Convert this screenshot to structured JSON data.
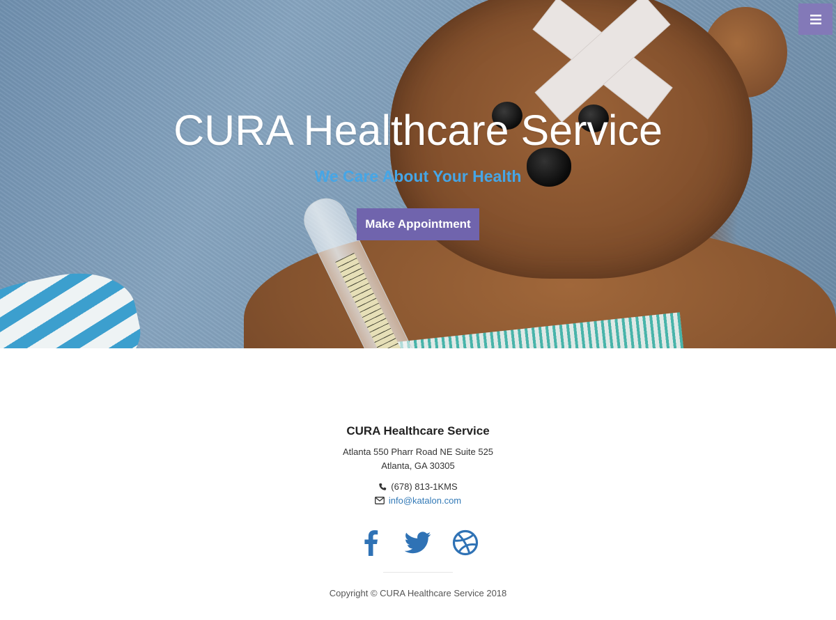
{
  "hero": {
    "title": "CURA Healthcare Service",
    "subtitle": "We Care About Your Health",
    "button_label": "Make Appointment"
  },
  "menu": {
    "icon": "menu-icon"
  },
  "footer": {
    "title": "CURA Healthcare Service",
    "address_line1": "Atlanta 550 Pharr Road NE Suite 525",
    "address_line2": "Atlanta, GA 30305",
    "phone": "(678) 813-1KMS",
    "email": "info@katalon.com",
    "socials": [
      {
        "icon": "facebook-icon"
      },
      {
        "icon": "twitter-icon"
      },
      {
        "icon": "dribbble-icon"
      }
    ],
    "copyright": "Copyright © CURA Healthcare Service 2018"
  },
  "colors": {
    "accent": "#7064ad",
    "menu_bg": "#8379b8",
    "subtitle": "#46a6e6",
    "link": "#337ab7",
    "social": "#2f72b5"
  }
}
